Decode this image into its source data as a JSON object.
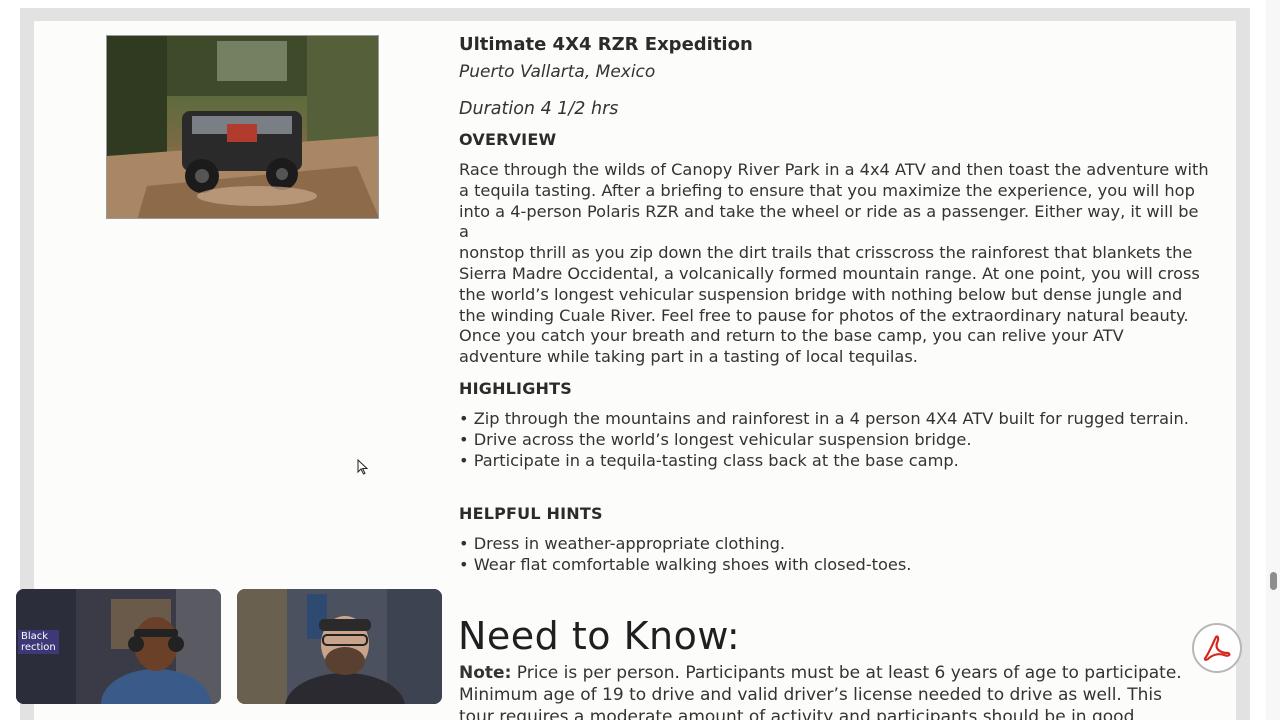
{
  "tour": {
    "title": "Ultimate 4X4 RZR Expedition",
    "location": "Puerto Vallarta, Mexico",
    "duration": "Duration 4 1/2 hrs"
  },
  "overview": {
    "heading": "OVERVIEW",
    "lines": [
      "Race through the wilds of Canopy River Park in a 4x4 ATV and then toast the adventure with",
      "a tequila tasting. After a briefing to ensure that you maximize the experience, you will hop",
      "into a 4-person Polaris RZR and take the wheel or ride as a passenger. Either way, it will be a",
      "nonstop thrill as you zip down the dirt trails that crisscross the rainforest that blankets the",
      "Sierra Madre Occidental, a volcanically formed mountain range. At one point, you will cross",
      "the world’s longest vehicular suspension bridge with nothing below but dense jungle and",
      "the winding Cuale River. Feel free to pause for photos of the extraordinary natural beauty.",
      "Once you catch your breath and return to the base camp, you can relive your ATV",
      "adventure while taking part in a tasting of local tequilas."
    ]
  },
  "highlights": {
    "heading": "HIGHLIGHTS",
    "items": [
      "• Zip through the mountains and rainforest in a 4 person 4X4 ATV built for rugged terrain.",
      "• Drive across the world’s longest vehicular suspension bridge.",
      "• Participate in a tequila-tasting class back at the base camp."
    ]
  },
  "hints": {
    "heading": "HELPFUL HINTS",
    "items": [
      "• Dress in weather-appropriate clothing.",
      "• Wear flat comfortable walking shoes with closed-toes."
    ]
  },
  "need_to_know": {
    "heading": "Need to Know:",
    "note_label": "Note:",
    "note_lines": [
      " Price is per person. Participants must be at least 6 years of age to participate.",
      "Minimum age of 19 to drive and valid driver’s license needed to drive as well. This",
      "tour requires a moderate amount of activity and participants should be in good"
    ]
  },
  "video_tiles": {
    "left_caption_lines": [
      "Black",
      "rection"
    ]
  },
  "icons": {
    "pdf": "adobe-pdf-icon",
    "cursor": "mouse-pointer-icon"
  },
  "colors": {
    "pdf_red": "#d7261e",
    "frame_gray": "#e2e2e2",
    "card_bg": "#fcfcfa"
  }
}
